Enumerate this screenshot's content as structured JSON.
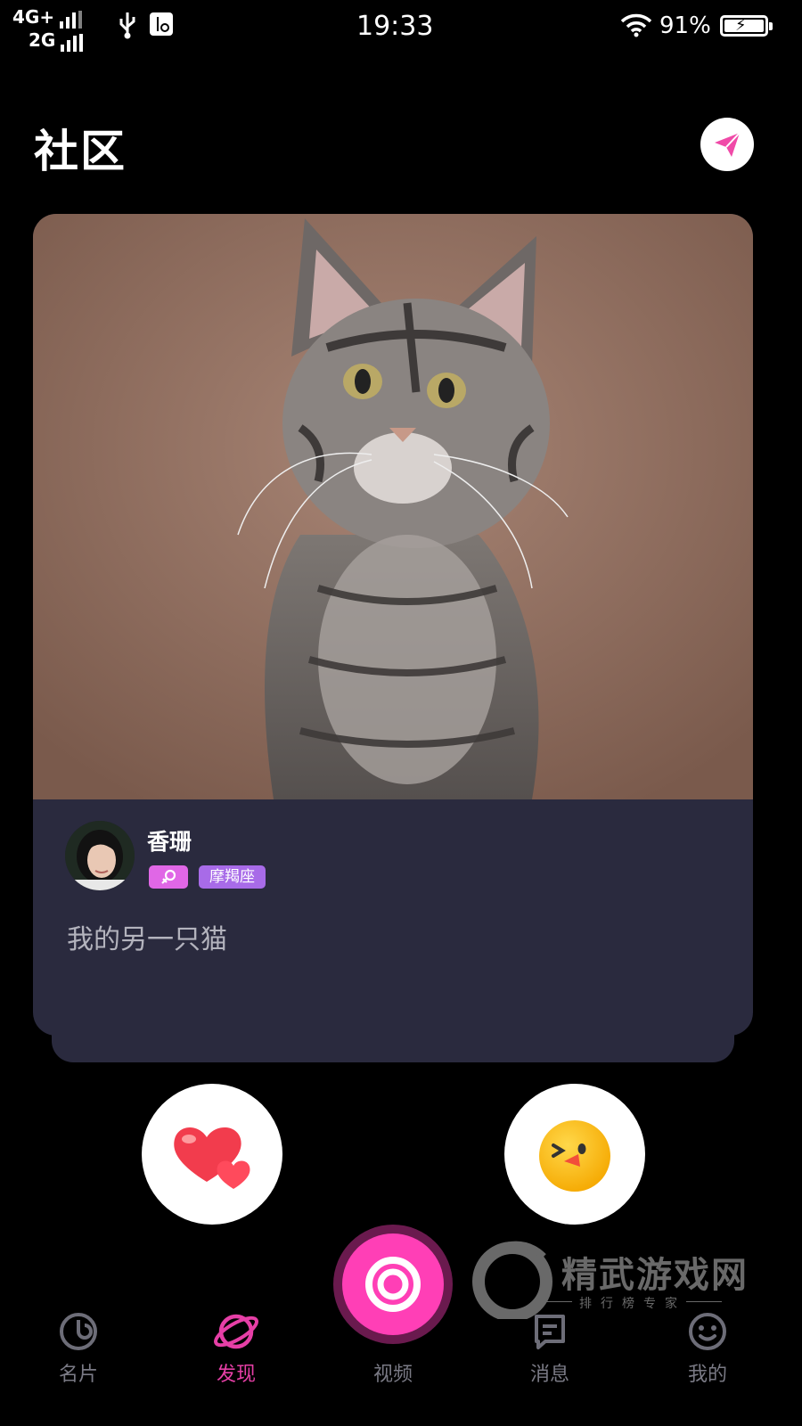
{
  "status_bar": {
    "network_top": "4G+",
    "network_bottom": "2G",
    "time": "19:33",
    "battery_percent": "91%",
    "battery_level": 0.91,
    "icons": [
      "signal-icon",
      "usb-icon",
      "usb-debug-icon",
      "wifi-icon",
      "battery-icon"
    ]
  },
  "header": {
    "title": "社区",
    "send_icon": "paper-plane-icon"
  },
  "post": {
    "image": "tabby-kitten-photo",
    "author": "香珊",
    "gender_icon": "female-symbol-icon",
    "zodiac": "摩羯座",
    "caption": "我的另一只猫"
  },
  "actions": {
    "like_icon": "hearts-icon",
    "emoji_icon": "winking-chick-emoji-icon"
  },
  "watermark": {
    "name": "精武游戏网",
    "subtitle": "排行榜专家"
  },
  "nav": {
    "items": [
      {
        "label": "名片",
        "icon": "card-icon"
      },
      {
        "label": "发现",
        "icon": "planet-icon"
      },
      {
        "label": "视频",
        "icon": "camera-icon"
      },
      {
        "label": "消息",
        "icon": "message-icon"
      },
      {
        "label": "我的",
        "icon": "smiley-icon"
      }
    ],
    "active_index": 1
  },
  "colors": {
    "accent": "#e63fa6",
    "card_bg": "#2a2a3e",
    "zodiac_tag": "#a86be8",
    "gender_tag": "#e067e6"
  }
}
